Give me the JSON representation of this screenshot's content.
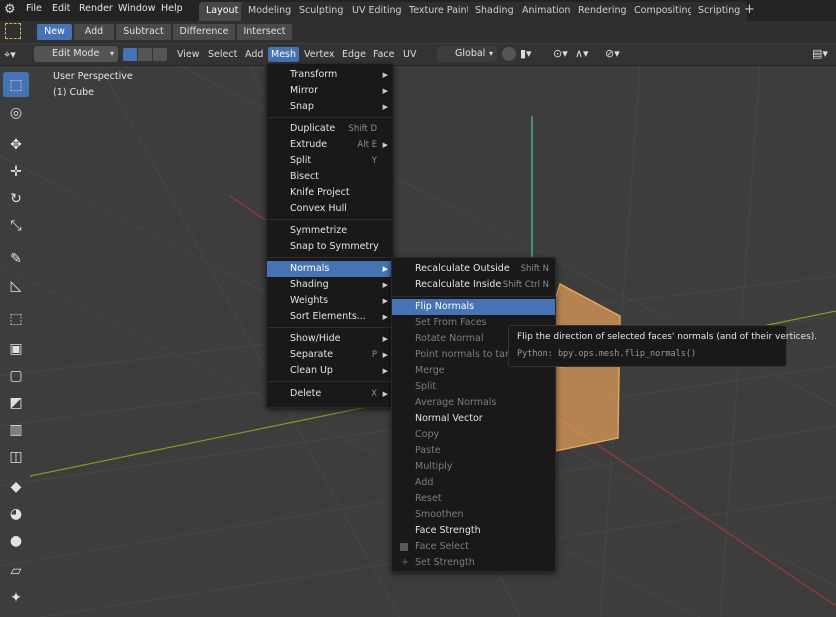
{
  "topbar": {
    "menus": [
      "File",
      "Edit",
      "Render",
      "Window",
      "Help"
    ],
    "workspaces": [
      "Layout",
      "Modeling",
      "Sculpting",
      "UV Editing",
      "Texture Paint",
      "Shading",
      "Animation",
      "Rendering",
      "Compositing",
      "Scripting"
    ],
    "add_workspace": "+"
  },
  "tool_options": {
    "buttons": [
      "New",
      "Add",
      "Subtract",
      "Difference",
      "Intersect"
    ]
  },
  "header": {
    "mode": "Edit Mode",
    "menus": [
      "View",
      "Select",
      "Add",
      "Mesh",
      "Vertex",
      "Edge",
      "Face",
      "UV"
    ],
    "orientation": "Global"
  },
  "viewport": {
    "perspective": "User Perspective",
    "object": "(1) Cube"
  },
  "mesh_menu": [
    {
      "label": "Transform",
      "submenu": true
    },
    {
      "label": "Mirror",
      "submenu": true
    },
    {
      "label": "Snap",
      "submenu": true
    },
    {
      "label": "Duplicate",
      "shortcut": "Shift D"
    },
    {
      "label": "Extrude",
      "shortcut": "Alt E",
      "submenu": true
    },
    {
      "label": "Split",
      "shortcut": "Y"
    },
    {
      "label": "Bisect"
    },
    {
      "label": "Knife Project"
    },
    {
      "label": "Convex Hull"
    },
    {
      "label": "Symmetrize"
    },
    {
      "label": "Snap to Symmetry"
    },
    {
      "label": "Normals",
      "submenu": true
    },
    {
      "label": "Shading",
      "submenu": true
    },
    {
      "label": "Weights",
      "submenu": true
    },
    {
      "label": "Sort Elements...",
      "submenu": true
    },
    {
      "label": "Show/Hide",
      "submenu": true
    },
    {
      "label": "Separate",
      "shortcut": "P",
      "submenu": true
    },
    {
      "label": "Clean Up",
      "submenu": true
    },
    {
      "label": "Delete",
      "shortcut": "X",
      "submenu": true
    }
  ],
  "normals_menu": [
    {
      "label": "Recalculate Outside",
      "shortcut": "Shift N"
    },
    {
      "label": "Recalculate Inside",
      "shortcut": "Shift Ctrl N"
    },
    {
      "label": "Flip Normals"
    },
    {
      "label": "Set From Faces"
    },
    {
      "label": "Rotate Normal"
    },
    {
      "label": "Point normals to target"
    },
    {
      "label": "Merge"
    },
    {
      "label": "Split"
    },
    {
      "label": "Average Normals"
    },
    {
      "label": "Normal Vector"
    },
    {
      "label": "Copy"
    },
    {
      "label": "Paste"
    },
    {
      "label": "Multiply"
    },
    {
      "label": "Add"
    },
    {
      "label": "Reset"
    },
    {
      "label": "Smoothen"
    },
    {
      "label": "Face Strength"
    },
    {
      "label": "Face Select"
    },
    {
      "label": "Set Strength"
    }
  ],
  "tooltip": {
    "description": "Flip the direction of selected faces' normals (and of their vertices).",
    "python": "Python: bpy.ops.mesh.flip_normals()"
  },
  "colors": {
    "accent": "#4772b3",
    "menu_bg": "#191919",
    "viewport_bg": "#3d3d3d",
    "x_axis": "#9b3b3b",
    "y_axis": "#79a12a",
    "z_axis": "#4fc3b8",
    "cube_face": "#e8a15a"
  }
}
